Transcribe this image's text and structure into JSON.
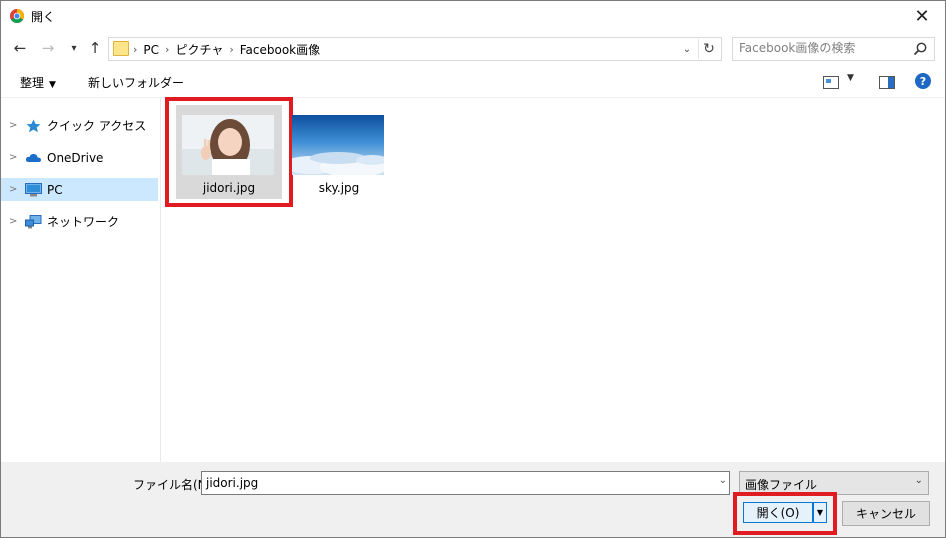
{
  "window": {
    "title": "開く",
    "close_label": "✕"
  },
  "nav": {
    "back": "←",
    "forward": "→",
    "recent": "▾",
    "up": "↑",
    "breadcrumb": [
      "PC",
      "ピクチャ",
      "Facebook画像"
    ],
    "separator": "›",
    "refresh": "↻",
    "search_placeholder": "Facebook画像の検索"
  },
  "toolbar": {
    "organize_label": "整理",
    "new_folder_label": "新しいフォルダー"
  },
  "sidebar": {
    "items": [
      {
        "label": "クイック アクセス",
        "icon": "star-icon",
        "selected": false
      },
      {
        "label": "OneDrive",
        "icon": "cloud-icon",
        "selected": false
      },
      {
        "label": "PC",
        "icon": "computer-icon",
        "selected": true
      },
      {
        "label": "ネットワーク",
        "icon": "network-icon",
        "selected": false
      }
    ]
  },
  "files": [
    {
      "name": "jidori.jpg",
      "selected": true
    },
    {
      "name": "sky.jpg",
      "selected": false
    }
  ],
  "footer": {
    "filename_label": "ファイル名(N):",
    "filename_value": "jidori.jpg",
    "filetype_value": "画像ファイル",
    "open_label": "開く(O)",
    "cancel_label": "キャンセル"
  },
  "colors": {
    "highlight": "#e11b22",
    "selection": "#cce8ff",
    "accent": "#0078d7"
  }
}
